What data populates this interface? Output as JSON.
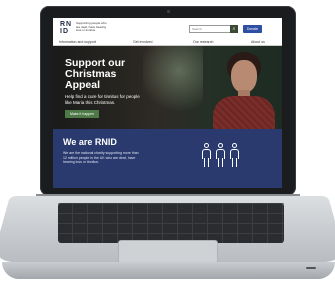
{
  "header": {
    "logo_line1": "RN",
    "logo_line2": "ID",
    "tagline": "Supporting people who are deaf, have hearing loss or tinnitus",
    "search_placeholder": "Search",
    "search_icon": "search-icon",
    "donate_label": "Donate"
  },
  "nav": {
    "items": [
      "Information and support",
      "Get involved",
      "Our research",
      "About us"
    ]
  },
  "hero": {
    "title": "Support our Christmas Appeal",
    "subtitle": "Help find a cure for tinnitus for people like Maria this Christmas.",
    "cta_label": "Make it happen"
  },
  "about": {
    "title": "We are RNID",
    "text": "We are the national charity supporting more than 12 million people in the UK who are deaf, have hearing loss or tinnitus."
  },
  "colors": {
    "donate": "#2e4fa3",
    "cta": "#4e7a47",
    "about_bg": "#2a3a6e"
  }
}
